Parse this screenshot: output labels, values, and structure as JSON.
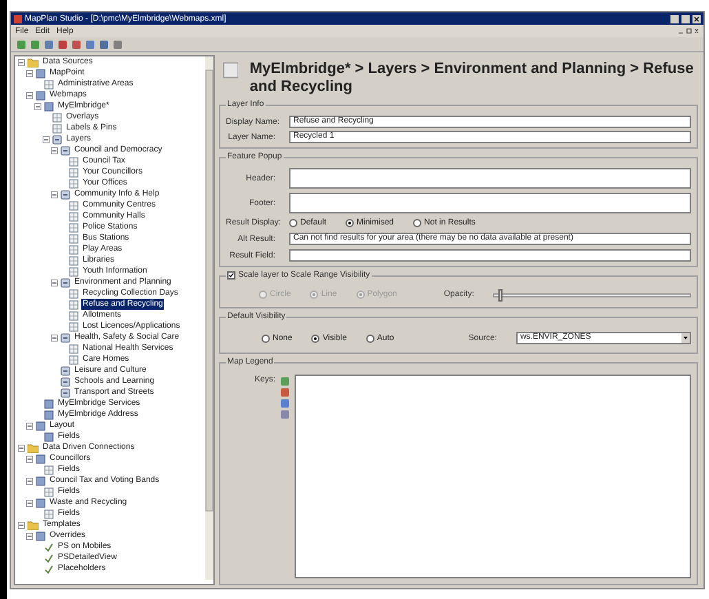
{
  "window": {
    "title": "MapPlan Studio - [D:\\pmc\\MyElmbridge\\Webmaps.xml]"
  },
  "menu": [
    "File",
    "Edit",
    "Help"
  ],
  "tree": [
    {
      "label": "Data Sources",
      "kind": "folder",
      "selected": false,
      "children": [
        {
          "label": "MapPoint",
          "kind": "db",
          "selected": false,
          "children": [
            {
              "label": "Administrative Areas",
              "kind": "layer",
              "selected": false
            }
          ]
        },
        {
          "label": "Webmaps",
          "kind": "db",
          "selected": false,
          "children": [
            {
              "label": "MyElmbridge*",
              "kind": "db",
              "selected": false,
              "children": [
                {
                  "label": "Overlays",
                  "kind": "layer",
                  "selected": false
                },
                {
                  "label": "Labels & Pins",
                  "kind": "layer",
                  "selected": false
                },
                {
                  "label": "Layers",
                  "kind": "group",
                  "selected": false,
                  "children": [
                    {
                      "label": "Council and Democracy",
                      "kind": "group",
                      "selected": false,
                      "children": [
                        {
                          "label": "Council Tax",
                          "kind": "layer",
                          "selected": false
                        },
                        {
                          "label": "Your Councillors",
                          "kind": "layer",
                          "selected": false
                        },
                        {
                          "label": "Your Offices",
                          "kind": "layer",
                          "selected": false
                        }
                      ]
                    },
                    {
                      "label": "Community Info & Help",
                      "kind": "group",
                      "selected": false,
                      "children": [
                        {
                          "label": "Community Centres",
                          "kind": "layer",
                          "selected": false
                        },
                        {
                          "label": "Community Halls",
                          "kind": "layer",
                          "selected": false
                        },
                        {
                          "label": "Police Stations",
                          "kind": "layer",
                          "selected": false
                        },
                        {
                          "label": "Bus Stations",
                          "kind": "layer",
                          "selected": false
                        },
                        {
                          "label": "Play Areas",
                          "kind": "layer",
                          "selected": false
                        },
                        {
                          "label": "Libraries",
                          "kind": "layer",
                          "selected": false
                        },
                        {
                          "label": "Youth Information",
                          "kind": "layer",
                          "selected": false
                        }
                      ]
                    },
                    {
                      "label": "Environment and Planning",
                      "kind": "group",
                      "selected": false,
                      "children": [
                        {
                          "label": "Recycling Collection Days",
                          "kind": "layer",
                          "selected": false
                        },
                        {
                          "label": "Refuse and Recycling",
                          "kind": "layer",
                          "selected": true
                        },
                        {
                          "label": "Allotments",
                          "kind": "layer",
                          "selected": false
                        },
                        {
                          "label": "Lost Licences/Applications",
                          "kind": "layer",
                          "selected": false
                        }
                      ]
                    },
                    {
                      "label": "Health, Safety & Social Care",
                      "kind": "group",
                      "selected": false,
                      "children": [
                        {
                          "label": "National Health Services",
                          "kind": "layer",
                          "selected": false
                        },
                        {
                          "label": "Care Homes",
                          "kind": "layer",
                          "selected": false
                        }
                      ]
                    },
                    {
                      "label": "Leisure and Culture",
                      "kind": "group",
                      "selected": false
                    },
                    {
                      "label": "Schools and Learning",
                      "kind": "group",
                      "selected": false
                    },
                    {
                      "label": "Transport and Streets",
                      "kind": "group",
                      "selected": false
                    }
                  ]
                }
              ]
            },
            {
              "label": "MyElmbridge Services",
              "kind": "db",
              "selected": false
            },
            {
              "label": "MyElmbridge Address",
              "kind": "db",
              "selected": false
            }
          ]
        },
        {
          "label": "Layout",
          "kind": "db",
          "selected": false,
          "children": [
            {
              "label": "Fields",
              "kind": "db",
              "selected": false
            }
          ]
        }
      ]
    },
    {
      "label": "Data Driven Connections",
      "kind": "folder",
      "selected": false,
      "children": [
        {
          "label": "Councillors",
          "kind": "db",
          "selected": false,
          "children": [
            {
              "label": "Fields",
              "kind": "layer",
              "selected": false
            }
          ]
        },
        {
          "label": "Council Tax and Voting Bands",
          "kind": "db",
          "selected": false,
          "children": [
            {
              "label": "Fields",
              "kind": "layer",
              "selected": false
            }
          ]
        },
        {
          "label": "Waste and Recycling",
          "kind": "db",
          "selected": false,
          "children": [
            {
              "label": "Fields",
              "kind": "layer",
              "selected": false
            }
          ]
        }
      ]
    },
    {
      "label": "Templates",
      "kind": "folder",
      "selected": false,
      "children": [
        {
          "label": "Overrides",
          "kind": "db",
          "selected": false,
          "children": [
            {
              "label": "PS on Mobiles",
              "kind": "check",
              "selected": false
            },
            {
              "label": "PSDetailedView",
              "kind": "check",
              "selected": false
            },
            {
              "label": "Placeholders",
              "kind": "check",
              "selected": false
            }
          ]
        }
      ]
    }
  ],
  "page": {
    "title": "MyElmbridge* > Layers > Environment and Planning > Refuse and Recycling",
    "layer_info": {
      "legend": "Layer Info",
      "fields": [
        {
          "label": "Display Name:",
          "value": "Refuse and Recycling"
        },
        {
          "label": "Layer Name:",
          "value": "Recycled 1"
        }
      ]
    },
    "feature_popup": {
      "legend": "Feature Popup",
      "header": {
        "label": "Header:"
      },
      "footer": {
        "label": "Footer:"
      },
      "result_display": {
        "label": "Result Display:",
        "options": [
          {
            "label": "Default",
            "selected": false
          },
          {
            "label": "Minimised",
            "selected": true
          },
          {
            "label": "Not in Results",
            "selected": false
          }
        ]
      },
      "alt_result": {
        "label": "Alt Result:",
        "value": "Can not find results for your area (there may be no data available at present)"
      },
      "result_field": {
        "label": "Result Field:"
      }
    },
    "scale": {
      "label": "Scale layer to Scale Range Visibility",
      "checked": true,
      "options": [
        {
          "label": "Circle",
          "selected": false,
          "disabled": true
        },
        {
          "label": "Line",
          "selected": true,
          "disabled": true
        },
        {
          "label": "Polygon",
          "selected": true,
          "disabled": true
        }
      ],
      "opacity": {
        "label": "Opacity:",
        "level": 0.02
      }
    },
    "visibility": {
      "legend": "Default Visibility",
      "options": [
        {
          "label": "None",
          "selected": false
        },
        {
          "label": "Visible",
          "selected": true
        },
        {
          "label": "Auto",
          "selected": false
        }
      ],
      "source": {
        "label": "Source:",
        "value": "ws.ENVIR_ZONES"
      }
    },
    "map_legend": {
      "legend": "Map Legend",
      "label": "Keys:"
    }
  }
}
